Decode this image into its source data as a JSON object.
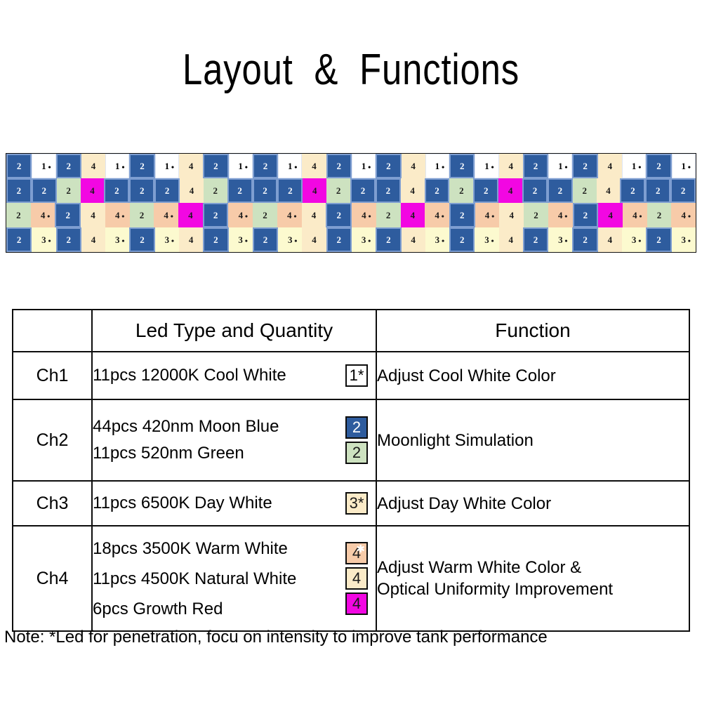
{
  "page": {
    "title": "Layout  &  Functions",
    "background": "#ffffff"
  },
  "colors": {
    "blue": "#2E5C9E",
    "white": "#FFFFFF",
    "cream": "#FBEBC8",
    "green": "#CDE2C0",
    "peach": "#F7CBA9",
    "magenta": "#F207E2",
    "light_yellow": "#FCFACF",
    "border": "#0D0D0D"
  },
  "led_strip": {
    "rows": 4,
    "columns": 28,
    "legend": {
      "1*": "Cool White 12000K",
      "2": "Moon Blue 420nm / Green 520nm",
      "3*": "Day White 6500K",
      "4": "Warm White 3500K / Natural White 4500K / Growth Red"
    },
    "grid": [
      [
        {
          "label": "2",
          "star": false,
          "color": "blue"
        },
        {
          "label": "1",
          "star": true,
          "color": "white"
        },
        {
          "label": "2",
          "star": false,
          "color": "blue"
        },
        {
          "label": "4",
          "star": false,
          "color": "cream"
        },
        {
          "label": "1",
          "star": true,
          "color": "white"
        },
        {
          "label": "2",
          "star": false,
          "color": "blue"
        },
        {
          "label": "1",
          "star": true,
          "color": "white"
        },
        {
          "label": "4",
          "star": false,
          "color": "cream"
        },
        {
          "label": "2",
          "star": false,
          "color": "blue"
        },
        {
          "label": "1",
          "star": true,
          "color": "white"
        },
        {
          "label": "2",
          "star": false,
          "color": "blue"
        },
        {
          "label": "1",
          "star": true,
          "color": "white"
        },
        {
          "label": "4",
          "star": false,
          "color": "cream"
        },
        {
          "label": "2",
          "star": false,
          "color": "blue"
        },
        {
          "label": "1",
          "star": true,
          "color": "white"
        },
        {
          "label": "2",
          "star": false,
          "color": "blue"
        },
        {
          "label": "4",
          "star": false,
          "color": "cream"
        },
        {
          "label": "1",
          "star": true,
          "color": "white"
        },
        {
          "label": "2",
          "star": false,
          "color": "blue"
        },
        {
          "label": "1",
          "star": true,
          "color": "white"
        },
        {
          "label": "4",
          "star": false,
          "color": "cream"
        },
        {
          "label": "2",
          "star": false,
          "color": "blue"
        },
        {
          "label": "1",
          "star": true,
          "color": "white"
        },
        {
          "label": "2",
          "star": false,
          "color": "blue"
        },
        {
          "label": "4",
          "star": false,
          "color": "cream"
        },
        {
          "label": "1",
          "star": true,
          "color": "white"
        },
        {
          "label": "2",
          "star": false,
          "color": "blue"
        },
        {
          "label": "1",
          "star": true,
          "color": "white"
        }
      ],
      [
        {
          "label": "2",
          "star": false,
          "color": "blue"
        },
        {
          "label": "2",
          "star": false,
          "color": "blue"
        },
        {
          "label": "2",
          "star": false,
          "color": "green"
        },
        {
          "label": "4",
          "star": false,
          "color": "magenta"
        },
        {
          "label": "2",
          "star": false,
          "color": "blue"
        },
        {
          "label": "2",
          "star": false,
          "color": "blue"
        },
        {
          "label": "2",
          "star": false,
          "color": "blue"
        },
        {
          "label": "4",
          "star": false,
          "color": "cream"
        },
        {
          "label": "2",
          "star": false,
          "color": "green"
        },
        {
          "label": "2",
          "star": false,
          "color": "blue"
        },
        {
          "label": "2",
          "star": false,
          "color": "blue"
        },
        {
          "label": "2",
          "star": false,
          "color": "blue"
        },
        {
          "label": "4",
          "star": false,
          "color": "magenta"
        },
        {
          "label": "2",
          "star": false,
          "color": "green"
        },
        {
          "label": "2",
          "star": false,
          "color": "blue"
        },
        {
          "label": "2",
          "star": false,
          "color": "blue"
        },
        {
          "label": "4",
          "star": false,
          "color": "cream"
        },
        {
          "label": "2",
          "star": false,
          "color": "blue"
        },
        {
          "label": "2",
          "star": false,
          "color": "green"
        },
        {
          "label": "2",
          "star": false,
          "color": "blue"
        },
        {
          "label": "4",
          "star": false,
          "color": "magenta"
        },
        {
          "label": "2",
          "star": false,
          "color": "blue"
        },
        {
          "label": "2",
          "star": false,
          "color": "blue"
        },
        {
          "label": "2",
          "star": false,
          "color": "green"
        },
        {
          "label": "4",
          "star": false,
          "color": "cream"
        },
        {
          "label": "2",
          "star": false,
          "color": "blue"
        },
        {
          "label": "2",
          "star": false,
          "color": "blue"
        },
        {
          "label": "2",
          "star": false,
          "color": "blue"
        }
      ],
      [
        {
          "label": "2",
          "star": false,
          "color": "green"
        },
        {
          "label": "4",
          "star": true,
          "color": "peach"
        },
        {
          "label": "2",
          "star": false,
          "color": "blue"
        },
        {
          "label": "4",
          "star": false,
          "color": "cream"
        },
        {
          "label": "4",
          "star": true,
          "color": "peach"
        },
        {
          "label": "2",
          "star": false,
          "color": "green"
        },
        {
          "label": "4",
          "star": true,
          "color": "peach"
        },
        {
          "label": "4",
          "star": false,
          "color": "magenta"
        },
        {
          "label": "2",
          "star": false,
          "color": "blue"
        },
        {
          "label": "4",
          "star": true,
          "color": "peach"
        },
        {
          "label": "2",
          "star": false,
          "color": "green"
        },
        {
          "label": "4",
          "star": true,
          "color": "peach"
        },
        {
          "label": "4",
          "star": false,
          "color": "cream"
        },
        {
          "label": "2",
          "star": false,
          "color": "blue"
        },
        {
          "label": "4",
          "star": true,
          "color": "peach"
        },
        {
          "label": "2",
          "star": false,
          "color": "green"
        },
        {
          "label": "4",
          "star": false,
          "color": "magenta"
        },
        {
          "label": "4",
          "star": true,
          "color": "peach"
        },
        {
          "label": "2",
          "star": false,
          "color": "blue"
        },
        {
          "label": "4",
          "star": true,
          "color": "peach"
        },
        {
          "label": "4",
          "star": false,
          "color": "cream"
        },
        {
          "label": "2",
          "star": false,
          "color": "green"
        },
        {
          "label": "4",
          "star": true,
          "color": "peach"
        },
        {
          "label": "2",
          "star": false,
          "color": "blue"
        },
        {
          "label": "4",
          "star": false,
          "color": "magenta"
        },
        {
          "label": "4",
          "star": true,
          "color": "peach"
        },
        {
          "label": "2",
          "star": false,
          "color": "green"
        },
        {
          "label": "4",
          "star": true,
          "color": "peach"
        }
      ],
      [
        {
          "label": "2",
          "star": false,
          "color": "blue"
        },
        {
          "label": "3",
          "star": true,
          "color": "lyellow"
        },
        {
          "label": "2",
          "star": false,
          "color": "blue"
        },
        {
          "label": "4",
          "star": false,
          "color": "cream"
        },
        {
          "label": "3",
          "star": true,
          "color": "lyellow"
        },
        {
          "label": "2",
          "star": false,
          "color": "blue"
        },
        {
          "label": "3",
          "star": true,
          "color": "lyellow"
        },
        {
          "label": "4",
          "star": false,
          "color": "cream"
        },
        {
          "label": "2",
          "star": false,
          "color": "blue"
        },
        {
          "label": "3",
          "star": true,
          "color": "lyellow"
        },
        {
          "label": "2",
          "star": false,
          "color": "blue"
        },
        {
          "label": "3",
          "star": true,
          "color": "lyellow"
        },
        {
          "label": "4",
          "star": false,
          "color": "cream"
        },
        {
          "label": "2",
          "star": false,
          "color": "blue"
        },
        {
          "label": "3",
          "star": true,
          "color": "lyellow"
        },
        {
          "label": "2",
          "star": false,
          "color": "blue"
        },
        {
          "label": "4",
          "star": false,
          "color": "cream"
        },
        {
          "label": "3",
          "star": true,
          "color": "lyellow"
        },
        {
          "label": "2",
          "star": false,
          "color": "blue"
        },
        {
          "label": "3",
          "star": true,
          "color": "lyellow"
        },
        {
          "label": "4",
          "star": false,
          "color": "cream"
        },
        {
          "label": "2",
          "star": false,
          "color": "blue"
        },
        {
          "label": "3",
          "star": true,
          "color": "lyellow"
        },
        {
          "label": "2",
          "star": false,
          "color": "blue"
        },
        {
          "label": "4",
          "star": false,
          "color": "cream"
        },
        {
          "label": "3",
          "star": true,
          "color": "lyellow"
        },
        {
          "label": "2",
          "star": false,
          "color": "blue"
        },
        {
          "label": "3",
          "star": true,
          "color": "lyellow"
        }
      ]
    ]
  },
  "table": {
    "headers": {
      "channel": "",
      "led_type": "Led Type and Quantity",
      "function": "Function"
    },
    "rows": [
      {
        "channel": "Ch1",
        "leds": [
          {
            "text": "11pcs 12000K Cool White",
            "badge_label": "1*",
            "badge_color": "white",
            "badge_star_sup": false
          }
        ],
        "function": "Adjust Cool White Color"
      },
      {
        "channel": "Ch2",
        "leds": [
          {
            "text": "44pcs 420nm Moon Blue",
            "badge_label": "2",
            "badge_color": "blue",
            "badge_star_sup": false
          },
          {
            "text": "11pcs 520nm Green",
            "badge_label": "2",
            "badge_color": "green",
            "badge_star_sup": false
          }
        ],
        "function": "Moonlight Simulation"
      },
      {
        "channel": "Ch3",
        "leds": [
          {
            "text": "11pcs 6500K Day White",
            "badge_label": "3*",
            "badge_color": "cream",
            "badge_star_sup": false
          }
        ],
        "function": "Adjust Day White Color"
      },
      {
        "channel": "Ch4",
        "leds": [
          {
            "text": "18pcs 3500K Warm White",
            "badge_label": "4",
            "badge_color": "peach",
            "badge_star_sup": true
          },
          {
            "text": "11pcs 4500K Natural White",
            "badge_label": "4",
            "badge_color": "cream",
            "badge_star_sup": false
          },
          {
            "text": "6pcs Growth Red",
            "badge_label": "4",
            "badge_color": "magenta",
            "badge_star_sup": false
          }
        ],
        "function_line1": "Adjust Warm White Color &",
        "function_line2": "Optical Uniformity Improvement"
      }
    ]
  },
  "footnote": {
    "text": "Note: *Led for penetration, focu on intensity to improve tank performance"
  }
}
